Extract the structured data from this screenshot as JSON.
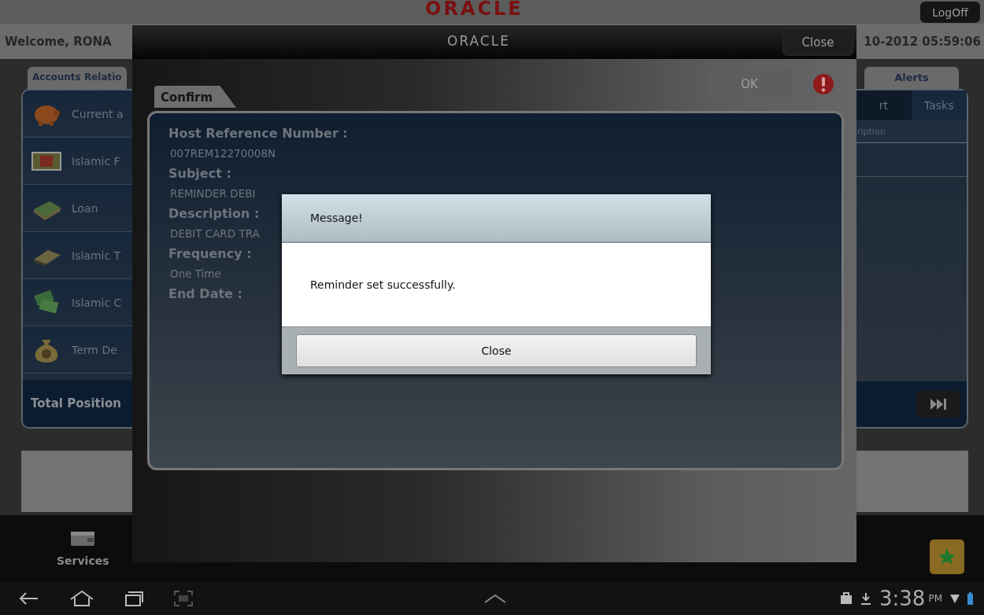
{
  "top_bar": {
    "logo": "ORACLE",
    "logoff": "LogOff"
  },
  "header": {
    "welcome": "Welcome, RONA",
    "datetime": "10-2012 05:59:06"
  },
  "left_panel": {
    "tab": "Accounts Relatio",
    "items": [
      {
        "label": "Current a",
        "kind": "piggy"
      },
      {
        "label": "Islamic F",
        "kind": "notes"
      },
      {
        "label": "Loan",
        "kind": "stack"
      },
      {
        "label": "Islamic T",
        "kind": "bundle"
      },
      {
        "label": "Islamic C",
        "kind": "bills"
      },
      {
        "label": "Term De",
        "kind": "bag"
      }
    ],
    "total": "Total Position"
  },
  "right_panel": {
    "tab": "Alerts",
    "subtabs": [
      {
        "label": "rt",
        "selected": false
      },
      {
        "label": "Tasks",
        "selected": true
      }
    ],
    "column": "ription"
  },
  "bottom_nav": {
    "items": [
      {
        "label": "Services"
      }
    ]
  },
  "system_bar": {
    "time": "3:38",
    "ampm": "PM"
  },
  "modal": {
    "logo": "ORACLE",
    "close": "Close",
    "tab": "Confirm",
    "ok": {
      "label": "OK",
      "disabled": true
    },
    "fields": [
      {
        "label": "Host Reference Number :",
        "value": "007REM12270008N"
      },
      {
        "label": "Subject :",
        "value": "REMINDER DEBI"
      },
      {
        "label": "Description :",
        "value": "DEBIT CARD TRA"
      },
      {
        "label": "Frequency :",
        "value": "One Time"
      },
      {
        "label": "End Date :"
      }
    ]
  },
  "message": {
    "title": "Message!",
    "text": "Reminder set successfully.",
    "button": "Close"
  }
}
